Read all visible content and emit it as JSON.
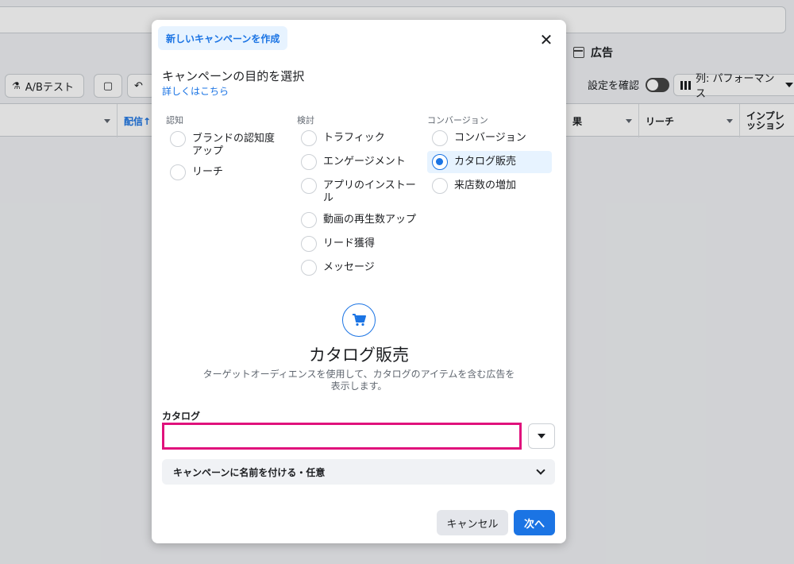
{
  "background": {
    "ads_tab_label": "広告",
    "ab_test_label": "A/Bテスト",
    "review_settings_label": "設定を確認",
    "columns_label": "列: パフォーマンス",
    "col_delivery": "配信↑",
    "col_result": "果",
    "col_reach": "リーチ",
    "col_impressions": "インプレッション"
  },
  "modal": {
    "tab_label": "新しいキャンペーンを作成",
    "close_symbol": "✕",
    "heading": "キャンペーンの目的を選択",
    "learn_more": "詳しくはこちら",
    "groups": [
      {
        "label": "認知",
        "options": [
          {
            "label": "ブランドの認知度アップ",
            "selected": false
          },
          {
            "label": "リーチ",
            "selected": false
          }
        ]
      },
      {
        "label": "検討",
        "options": [
          {
            "label": "トラフィック",
            "selected": false
          },
          {
            "label": "エンゲージメント",
            "selected": false
          },
          {
            "label": "アプリのインストール",
            "selected": false
          },
          {
            "label": "動画の再生数アップ",
            "selected": false
          },
          {
            "label": "リード獲得",
            "selected": false
          },
          {
            "label": "メッセージ",
            "selected": false
          }
        ]
      },
      {
        "label": "コンバージョン",
        "options": [
          {
            "label": "コンバージョン",
            "selected": false
          },
          {
            "label": "カタログ販売",
            "selected": true
          },
          {
            "label": "来店数の増加",
            "selected": false
          }
        ]
      }
    ],
    "selected_title": "カタログ販売",
    "selected_description": "ターゲットオーディエンスを使用して、カタログのアイテムを含む広告を表示します。",
    "catalog_label": "カタログ",
    "catalog_value": "",
    "name_campaign_label": "キャンペーンに名前を付ける・任意",
    "cancel_label": "キャンセル",
    "next_label": "次へ"
  },
  "colors": {
    "accent": "#1b74e4",
    "highlight_border": "#e0127c",
    "selected_bg": "#e7f3ff"
  }
}
